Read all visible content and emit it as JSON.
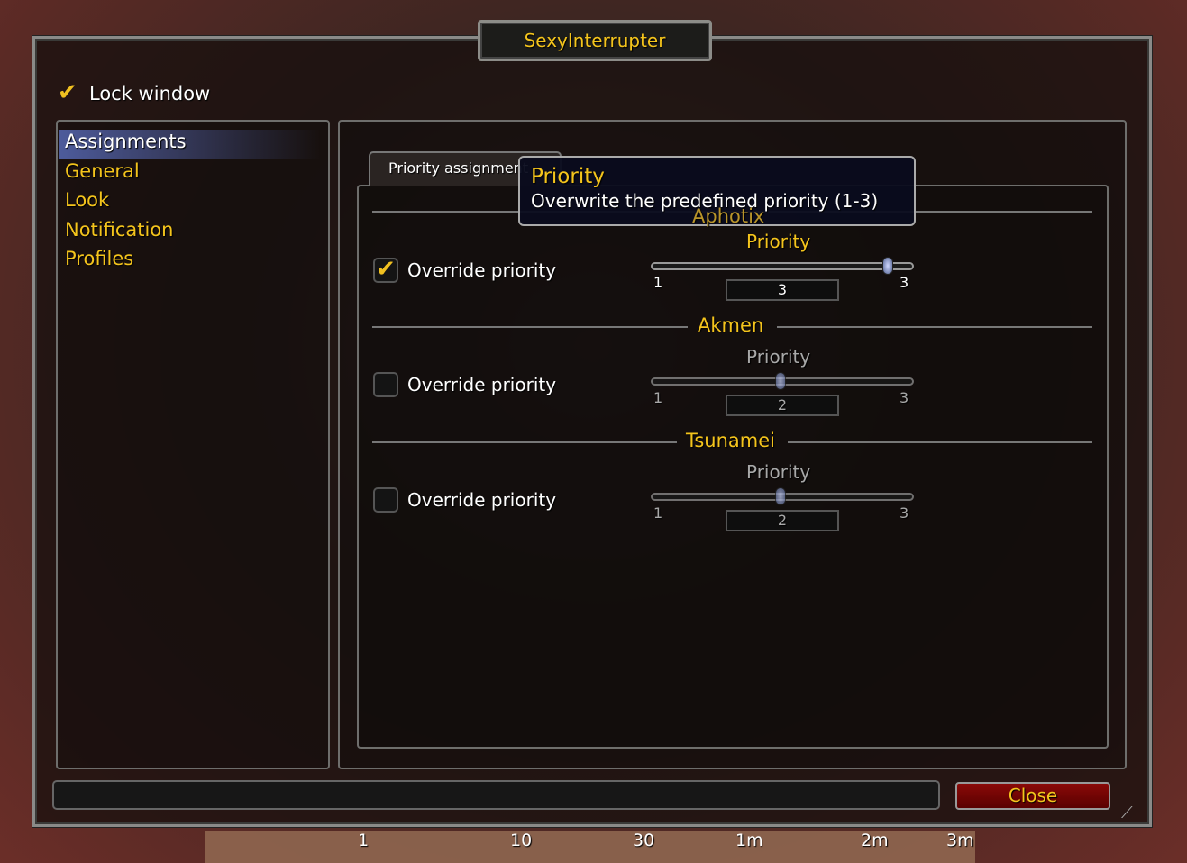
{
  "window": {
    "title": "SexyInterrupter",
    "lock_window": {
      "label": "Lock window",
      "checked": true
    },
    "close_label": "Close"
  },
  "sidebar": {
    "items": [
      {
        "label": "Assignments",
        "selected": true
      },
      {
        "label": "General"
      },
      {
        "label": "Look"
      },
      {
        "label": "Notification"
      },
      {
        "label": "Profiles"
      }
    ]
  },
  "tab": {
    "label": "Priority assignment"
  },
  "tooltip": {
    "title": "Priority",
    "text": "Overwrite the predefined priority (1-3)"
  },
  "sections": [
    {
      "name": "Aphotix",
      "checkbox_label": "Override priority",
      "checked": true,
      "slider_label": "Priority",
      "min": "1",
      "max": "3",
      "value": "3",
      "fraction": 1.0
    },
    {
      "name": "Akmen",
      "checkbox_label": "Override priority",
      "checked": false,
      "slider_label": "Priority",
      "min": "1",
      "max": "3",
      "value": "2",
      "fraction": 0.5
    },
    {
      "name": "Tsunamei",
      "checkbox_label": "Override priority",
      "checked": false,
      "slider_label": "Priority",
      "min": "1",
      "max": "3",
      "value": "2",
      "fraction": 0.5
    }
  ],
  "timeline": {
    "ticks": [
      "1",
      "10",
      "30",
      "1m",
      "2m",
      "3m"
    ]
  },
  "colors": {
    "accent": "#f4c41c",
    "close_button": "#7a0806",
    "selection": "#5a6ebe"
  }
}
